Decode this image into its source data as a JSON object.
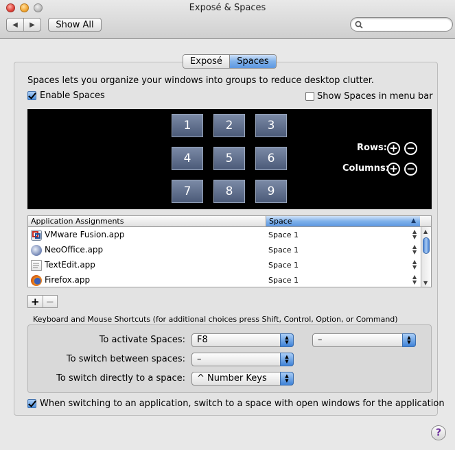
{
  "window": {
    "title": "Exposé & Spaces",
    "show_all": "Show All",
    "back_icon": "◀",
    "forward_icon": "▶",
    "search_placeholder": ""
  },
  "tabs": [
    {
      "label": "Exposé",
      "selected": false
    },
    {
      "label": "Spaces",
      "selected": true
    }
  ],
  "description": "Spaces lets you organize your windows into groups to reduce desktop clutter.",
  "enable_spaces": {
    "label": "Enable Spaces",
    "checked": true
  },
  "show_in_menu_bar": {
    "label": "Show Spaces in menu bar",
    "checked": false
  },
  "spaces_grid": {
    "spaces": [
      "1",
      "2",
      "3",
      "4",
      "5",
      "6",
      "7",
      "8",
      "9"
    ],
    "rows_label": "Rows:",
    "columns_label": "Columns:",
    "add_symbol": "+",
    "remove_symbol": "−"
  },
  "assignments": {
    "col_app": "Application Assignments",
    "col_space": "Space",
    "sort_icon": "▲",
    "rows": [
      {
        "app": "VMware Fusion.app",
        "space": "Space 1",
        "icon": "vmware-icon"
      },
      {
        "app": "NeoOffice.app",
        "space": "Space 1",
        "icon": "neooffice-icon"
      },
      {
        "app": "TextEdit.app",
        "space": "Space 1",
        "icon": "textedit-icon"
      },
      {
        "app": "Firefox.app",
        "space": "Space 1",
        "icon": "firefox-icon"
      }
    ],
    "add_label": "+",
    "remove_label": "−"
  },
  "shortcuts": {
    "section_title": "Keyboard and Mouse Shortcuts (for additional choices press Shift, Control, Option, or Command)",
    "activate_label": "To activate Spaces:",
    "activate_value": "F8",
    "activate_mouse_value": "–",
    "switch_between_label": "To switch between spaces:",
    "switch_between_value": "–",
    "switch_direct_label": "To switch directly to a space:",
    "switch_direct_value": "^ Number Keys"
  },
  "switch_app": {
    "label": "When switching to an application, switch to a space with open windows for the application",
    "checked": true
  },
  "help": "?"
}
